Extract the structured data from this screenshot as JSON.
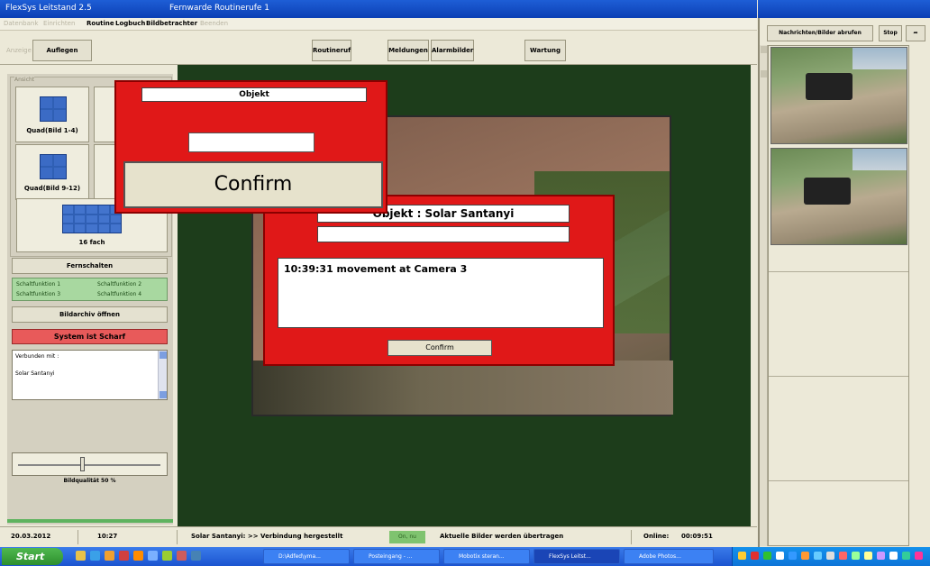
{
  "window": {
    "title": "FlexSys Leitstand 2.5",
    "subtitle": "Fernwarde Routinerufe 1"
  },
  "menu": [
    {
      "label": "Datenbank",
      "disabled": true
    },
    {
      "label": "Einrichten",
      "disabled": true
    },
    {
      "label": "Routine",
      "disabled": false
    },
    {
      "label": "Logbuch",
      "disabled": false
    },
    {
      "label": "Bildbetrachter",
      "disabled": false
    },
    {
      "label": "Beenden",
      "disabled": true
    }
  ],
  "toolbar": {
    "anzeige": "Anzeige",
    "auflegen": "Auflegen",
    "routineruf": "Routineruf",
    "meldungen": "Meldungen",
    "alarmbilder": "Alarmbilder",
    "wartung": "Wartung"
  },
  "left": {
    "group_label": "Ansicht",
    "quad1": "Quad(Bild 1-4)",
    "quad2": "Qu",
    "quad3": "Quad(Bild 9-12)",
    "quad4": "Qu",
    "big": "16 fach",
    "fernschalten": "Fernschalten",
    "switches": [
      "Schaltfunktion 1",
      "Schaltfunktion 2",
      "Schaltfunktion 3",
      "Schaltfunktion 4"
    ],
    "archive": "Bildarchiv öffnen",
    "system_status": "System ist Scharf",
    "connected_label": "Verbunden mit :",
    "connected_value": "Solar Santanyi",
    "quality": "Bildqualität 50 %",
    "quality_value": 0.45
  },
  "popup_small": {
    "title": "Objekt",
    "field": "",
    "confirm": "Confirm"
  },
  "popup_main": {
    "title": "Objekt : Solar Santanyi",
    "subtitle": "",
    "message": "10:39:31  movement at  Camera 3",
    "confirm": "Confirm"
  },
  "status": {
    "date": "20.03.2012",
    "time": "10:27",
    "connection": "Solar Santanyi:  >> Verbindung hergestellt",
    "mode": "On, nu",
    "transfer": "Aktuelle Bilder werden übertragen",
    "online_label": "Online:",
    "online_value": "00:09:51"
  },
  "right_panel": {
    "fetch": "Nachrichten/Bilder abrufen",
    "stop": "Stop"
  },
  "taskbar": {
    "start": "Start",
    "tasks": [
      "D:\\Adfed\\yma...",
      "Posteingang - ...",
      "Mobotix steran...",
      "FlexSys Leitst...",
      "Adobe Photos..."
    ]
  },
  "colors": {
    "alarm_red": "#e01818",
    "workspace_green": "#1d3d1b",
    "title_blue": "#1e5ed6"
  }
}
